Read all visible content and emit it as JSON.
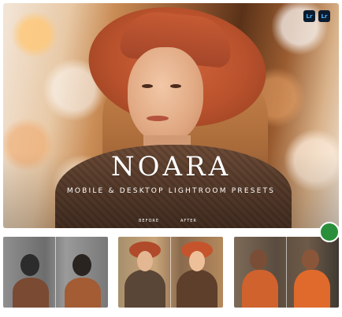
{
  "hero": {
    "title": "NOARA",
    "subtitle": "MOBILE & DESKTOP LIGHTROOM PRESETS",
    "before_label": "BEFORE",
    "after_label": "AFTER"
  },
  "badges": [
    {
      "label": "Lr"
    },
    {
      "label": "Lr"
    }
  ],
  "colors": {
    "badge_bg": "#0c1c2e",
    "badge_text": "#4fb3ff",
    "hat": "#b8512c",
    "watermark": "#3cb43c"
  }
}
